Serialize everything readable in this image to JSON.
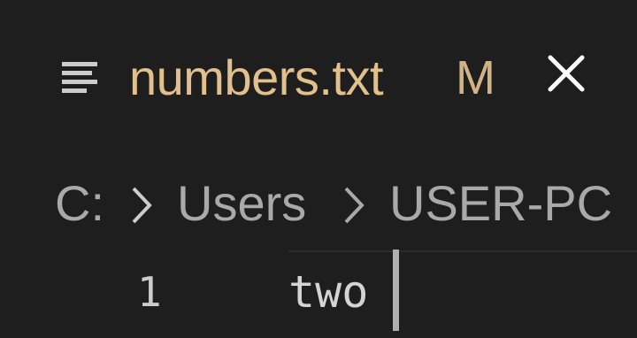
{
  "tab": {
    "icon": "text-lines-icon",
    "filename": "numbers.txt",
    "status": "M",
    "close_icon": "close-icon"
  },
  "breadcrumb": {
    "items": [
      "C:",
      "Users",
      "USER-PC"
    ],
    "separator_icon": "chevron-right-icon"
  },
  "editor": {
    "lines": [
      {
        "number": "1",
        "text": "two"
      }
    ]
  },
  "colors": {
    "background": "#1e1e1e",
    "modified": "#e2c08d",
    "breadcrumb": "#a9a9a9",
    "text": "#d4d4d4",
    "cursor": "#aeafad"
  }
}
